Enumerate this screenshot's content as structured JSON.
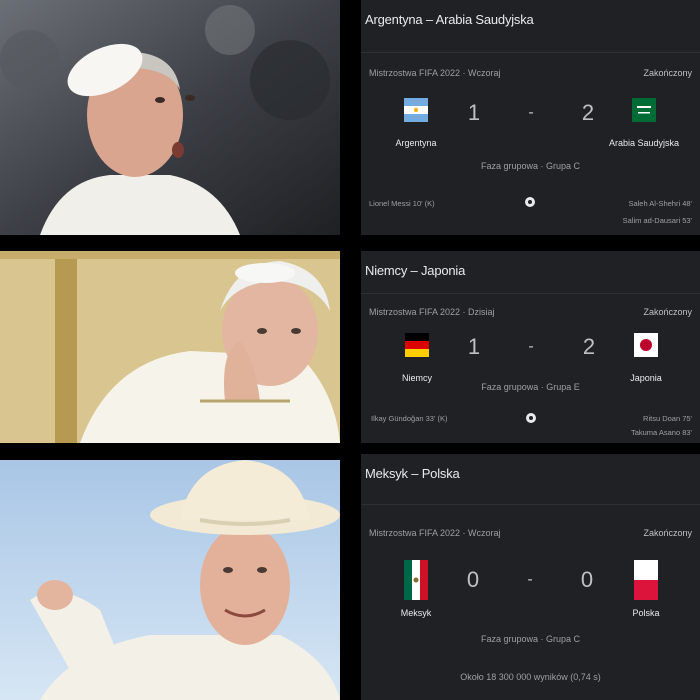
{
  "panels": [
    {
      "title": "Argentyna – Arabia Saudyjska",
      "competition": "Mistrzostwa FIFA 2022 · Wczoraj",
      "status": "Zakończony",
      "home": {
        "name": "Argentyna",
        "score": "1",
        "flag": "argentina-flag-icon"
      },
      "away": {
        "name": "Arabia Saudyjska",
        "score": "2",
        "flag": "saudi-arabia-flag-icon"
      },
      "dash": "-",
      "stage": "Faza grupowa · Grupa C",
      "home_scorers": [
        "Lionel Messi 10' (K)"
      ],
      "away_scorers": [
        "Saleh Al-Shehri 48'",
        "Salim ad-Dausari 53'"
      ]
    },
    {
      "title": "Niemcy – Japonia",
      "competition": "Mistrzostwa FIFA 2022 · Dzisiaj",
      "status": "Zakończony",
      "home": {
        "name": "Niemcy",
        "score": "1",
        "flag": "germany-flag-icon"
      },
      "away": {
        "name": "Japonia",
        "score": "2",
        "flag": "japan-flag-icon"
      },
      "dash": "-",
      "stage": "Faza grupowa · Grupa E",
      "home_scorers": [
        "Ilkay Gündoğan 33' (K)"
      ],
      "away_scorers": [
        "Ritsu Doan 75'",
        "Takuma Asano 83'"
      ]
    },
    {
      "title": "Meksyk – Polska",
      "competition": "Mistrzostwa FIFA 2022 · Wczoraj",
      "status": "Zakończony",
      "home": {
        "name": "Meksyk",
        "score": "0",
        "flag": "mexico-flag-icon"
      },
      "away": {
        "name": "Polska",
        "score": "0",
        "flag": "poland-flag-icon"
      },
      "dash": "-",
      "stage": "Faza grupowa · Grupa C",
      "results_count": "Około 18 300 000 wyników (0,74 s)"
    }
  ],
  "colors": {
    "card_bg": "#202124",
    "text_primary": "#e8eaed",
    "text_secondary": "#9aa0a6"
  }
}
